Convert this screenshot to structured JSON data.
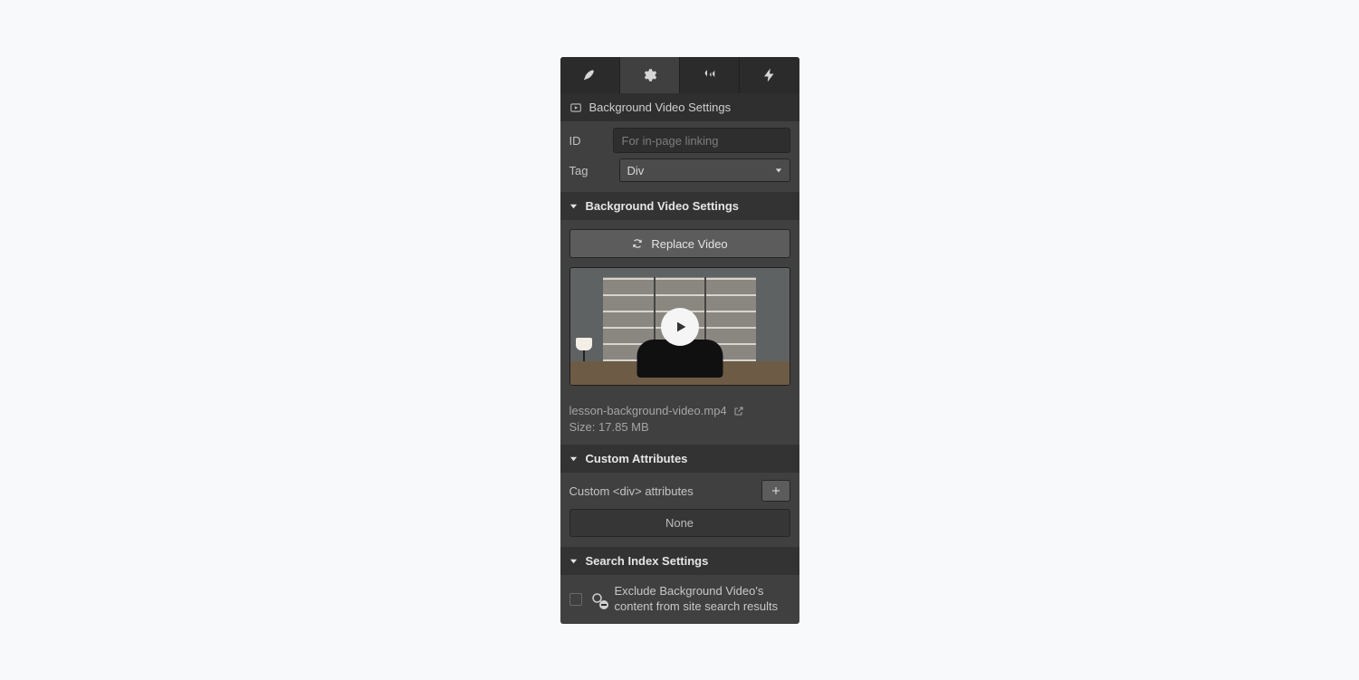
{
  "subheader": {
    "title": "Background Video Settings"
  },
  "form": {
    "id_label": "ID",
    "id_placeholder": "For in-page linking",
    "tag_label": "Tag",
    "tag_value": "Div"
  },
  "sections": {
    "bgvideo": "Background Video Settings",
    "custom": "Custom Attributes",
    "search": "Search Index Settings"
  },
  "video": {
    "replace_label": "Replace Video",
    "filename": "lesson-background-video.mp4",
    "size_label": "Size: 17.85 MB"
  },
  "custom": {
    "label": "Custom <div> attributes",
    "none": "None"
  },
  "search": {
    "exclude_text": "Exclude Background Video's content from site search results"
  }
}
